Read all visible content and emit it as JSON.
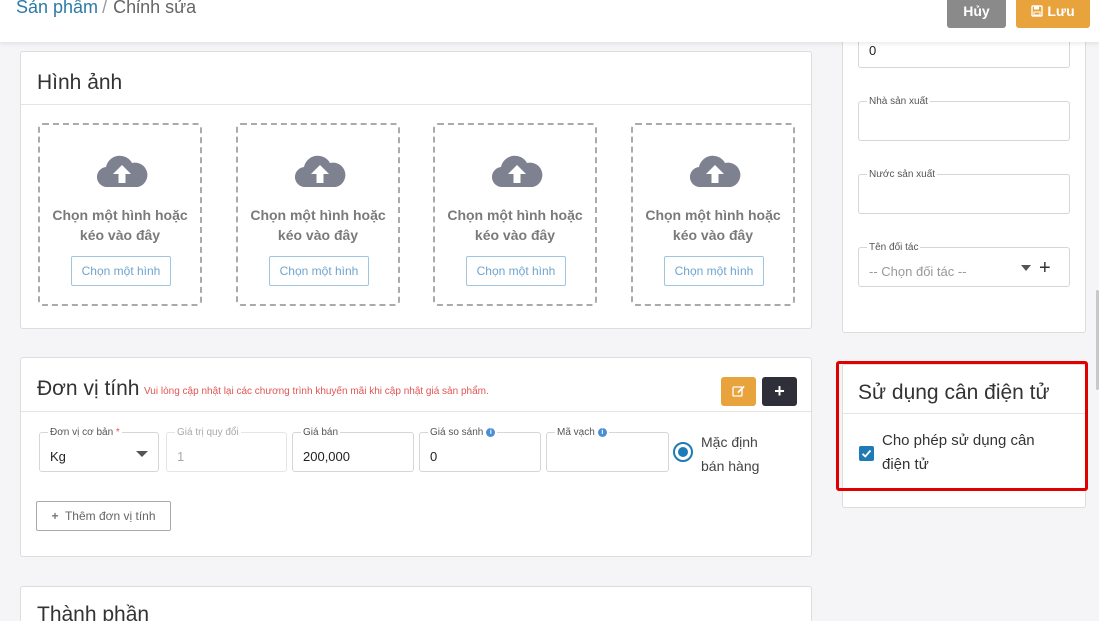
{
  "header": {
    "breadcrumb_root": "Sản phẩm",
    "breadcrumb_sep": "/",
    "breadcrumb_current": "Chỉnh sửa",
    "cancel_label": "Hủy",
    "save_label": "Lưu"
  },
  "images": {
    "title": "Hình ảnh",
    "slots": [
      {
        "text": "Chọn một hình hoặc kéo vào đây",
        "button": "Chọn một hình"
      },
      {
        "text": "Chọn một hình hoặc kéo vào đây",
        "button": "Chọn một hình"
      },
      {
        "text": "Chọn một hình hoặc kéo vào đây",
        "button": "Chọn một hình"
      },
      {
        "text": "Chọn một hình hoặc kéo vào đây",
        "button": "Chọn một hình"
      }
    ]
  },
  "unit": {
    "title": "Đơn vị tính",
    "warning": "Vui lòng cập nhật lại các chương trình khuyến mãi khi cập nhật giá sản phẩm.",
    "fields": {
      "base_unit": {
        "label": "Đơn vị cơ bản",
        "required_mark": "*",
        "value": "Kg"
      },
      "conversion": {
        "label": "Giá trị quy đổi",
        "value": "1"
      },
      "price": {
        "label": "Giá bán",
        "value": "200,000"
      },
      "compare_price": {
        "label": "Giá so sánh",
        "value": "0"
      },
      "barcode": {
        "label": "Mã vạch",
        "value": ""
      }
    },
    "default_sale_label": "Mặc định bán hàng",
    "add_unit_label": "Thêm đơn vị tính"
  },
  "ingredients": {
    "title": "Thành phần"
  },
  "right_panel": {
    "top_value": "0",
    "manufacturer_label": "Nhà sản xuất",
    "manufacturer_value": "",
    "country_label": "Nước sản xuất",
    "country_value": "",
    "partner_label": "Tên đối tác",
    "partner_placeholder": "-- Chọn đối tác --"
  },
  "scale": {
    "title": "Sử dụng cân điện tử",
    "checkbox_label": "Cho phép sử dụng cân điện tử",
    "checked": true
  },
  "colors": {
    "accent_blue": "#1f7bb5",
    "save_orange": "#e8a33d",
    "cancel_gray": "#8a8a8a",
    "highlight_red": "#e00000"
  }
}
